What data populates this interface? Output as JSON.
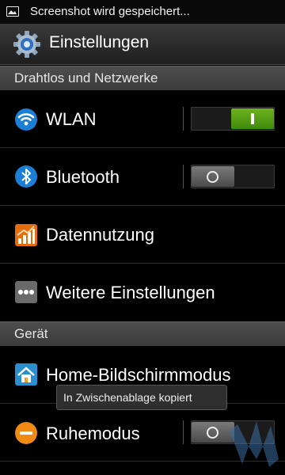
{
  "status_bar": {
    "notification_text": "Screenshot wird gespeichert..."
  },
  "title_bar": {
    "title": "Einstellungen"
  },
  "sections": {
    "wireless": "Drahtlos und Netzwerke",
    "device": "Gerät"
  },
  "items": {
    "wlan": {
      "label": "WLAN",
      "toggle_on": true
    },
    "bluetooth": {
      "label": "Bluetooth",
      "toggle_on": false
    },
    "data_usage": {
      "label": "Datennutzung"
    },
    "more_settings": {
      "label": "Weitere Einstellungen"
    },
    "home_screen_mode": {
      "label": "Home-Bildschirmmodus"
    },
    "sleep_mode": {
      "label": "Ruhemodus",
      "toggle_on": false
    }
  },
  "toast": {
    "text": "In Zwischenablage kopiert"
  },
  "colors": {
    "toggle_on": "#4e9d12",
    "toggle_off": "#5a5a5a",
    "section_bg": "#444444"
  },
  "icons": {
    "status_image": "image-icon",
    "settings": "gear-icon",
    "wlan": "wifi-icon",
    "bluetooth": "bluetooth-icon",
    "data_usage": "data-usage-icon",
    "more_settings": "more-dots-icon",
    "home_screen_mode": "home-icon",
    "sleep_mode": "sleep-mode-icon"
  }
}
